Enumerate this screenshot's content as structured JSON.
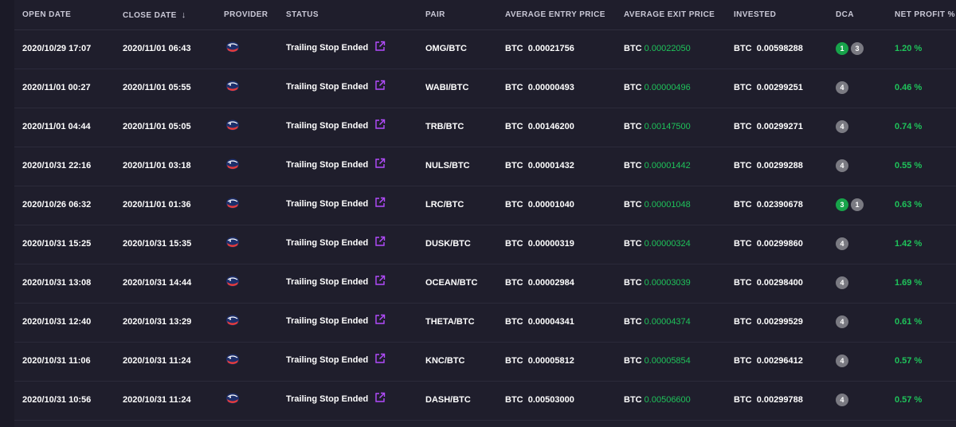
{
  "columns": {
    "open_date": "OPEN DATE",
    "close_date": "CLOSE DATE",
    "provider": "PROVIDER",
    "status": "STATUS",
    "pair": "PAIR",
    "avg_entry": "AVERAGE ENTRY PRICE",
    "avg_exit": "AVERAGE EXIT PRICE",
    "invested": "INVESTED",
    "dca": "DCA",
    "net_profit": "NET PROFIT %"
  },
  "icons": {
    "sort": "arrow-down-icon",
    "provider": "provider-logo-icon",
    "external": "external-link-icon"
  },
  "colors": {
    "background": "#1f1e2c",
    "profit_green": "#1fc35a",
    "dca_green": "#17a34a",
    "dca_grey": "#7a7a82",
    "link_purple": "#b44cff"
  },
  "rows": [
    {
      "open": "2020/10/29 17:07",
      "close": "2020/11/01 06:43",
      "status": "Trailing Stop Ended",
      "pair": "OMG/BTC",
      "entry_cur": "BTC",
      "entry": "0.00021756",
      "exit_cur": "BTC",
      "exit": "0.00022050",
      "inv_cur": "BTC",
      "invested": "0.00598288",
      "dca": [
        {
          "v": "1",
          "c": "green"
        },
        {
          "v": "3",
          "c": "grey"
        }
      ],
      "profit": "1.20 %"
    },
    {
      "open": "2020/11/01 00:27",
      "close": "2020/11/01 05:55",
      "status": "Trailing Stop Ended",
      "pair": "WABI/BTC",
      "entry_cur": "BTC",
      "entry": "0.00000493",
      "exit_cur": "BTC",
      "exit": "0.00000496",
      "inv_cur": "BTC",
      "invested": "0.00299251",
      "dca": [
        {
          "v": "4",
          "c": "grey"
        }
      ],
      "profit": "0.46 %"
    },
    {
      "open": "2020/11/01 04:44",
      "close": "2020/11/01 05:05",
      "status": "Trailing Stop Ended",
      "pair": "TRB/BTC",
      "entry_cur": "BTC",
      "entry": "0.00146200",
      "exit_cur": "BTC",
      "exit": "0.00147500",
      "inv_cur": "BTC",
      "invested": "0.00299271",
      "dca": [
        {
          "v": "4",
          "c": "grey"
        }
      ],
      "profit": "0.74 %"
    },
    {
      "open": "2020/10/31 22:16",
      "close": "2020/11/01 03:18",
      "status": "Trailing Stop Ended",
      "pair": "NULS/BTC",
      "entry_cur": "BTC",
      "entry": "0.00001432",
      "exit_cur": "BTC",
      "exit": "0.00001442",
      "inv_cur": "BTC",
      "invested": "0.00299288",
      "dca": [
        {
          "v": "4",
          "c": "grey"
        }
      ],
      "profit": "0.55 %"
    },
    {
      "open": "2020/10/26 06:32",
      "close": "2020/11/01 01:36",
      "status": "Trailing Stop Ended",
      "pair": "LRC/BTC",
      "entry_cur": "BTC",
      "entry": "0.00001040",
      "exit_cur": "BTC",
      "exit": "0.00001048",
      "inv_cur": "BTC",
      "invested": "0.02390678",
      "dca": [
        {
          "v": "3",
          "c": "green"
        },
        {
          "v": "1",
          "c": "grey"
        }
      ],
      "profit": "0.63 %"
    },
    {
      "open": "2020/10/31 15:25",
      "close": "2020/10/31 15:35",
      "status": "Trailing Stop Ended",
      "pair": "DUSK/BTC",
      "entry_cur": "BTC",
      "entry": "0.00000319",
      "exit_cur": "BTC",
      "exit": "0.00000324",
      "inv_cur": "BTC",
      "invested": "0.00299860",
      "dca": [
        {
          "v": "4",
          "c": "grey"
        }
      ],
      "profit": "1.42 %"
    },
    {
      "open": "2020/10/31 13:08",
      "close": "2020/10/31 14:44",
      "status": "Trailing Stop Ended",
      "pair": "OCEAN/BTC",
      "entry_cur": "BTC",
      "entry": "0.00002984",
      "exit_cur": "BTC",
      "exit": "0.00003039",
      "inv_cur": "BTC",
      "invested": "0.00298400",
      "dca": [
        {
          "v": "4",
          "c": "grey"
        }
      ],
      "profit": "1.69 %"
    },
    {
      "open": "2020/10/31 12:40",
      "close": "2020/10/31 13:29",
      "status": "Trailing Stop Ended",
      "pair": "THETA/BTC",
      "entry_cur": "BTC",
      "entry": "0.00004341",
      "exit_cur": "BTC",
      "exit": "0.00004374",
      "inv_cur": "BTC",
      "invested": "0.00299529",
      "dca": [
        {
          "v": "4",
          "c": "grey"
        }
      ],
      "profit": "0.61 %"
    },
    {
      "open": "2020/10/31 11:06",
      "close": "2020/10/31 11:24",
      "status": "Trailing Stop Ended",
      "pair": "KNC/BTC",
      "entry_cur": "BTC",
      "entry": "0.00005812",
      "exit_cur": "BTC",
      "exit": "0.00005854",
      "inv_cur": "BTC",
      "invested": "0.00296412",
      "dca": [
        {
          "v": "4",
          "c": "grey"
        }
      ],
      "profit": "0.57 %"
    },
    {
      "open": "2020/10/31 10:56",
      "close": "2020/10/31 11:24",
      "status": "Trailing Stop Ended",
      "pair": "DASH/BTC",
      "entry_cur": "BTC",
      "entry": "0.00503000",
      "exit_cur": "BTC",
      "exit": "0.00506600",
      "inv_cur": "BTC",
      "invested": "0.00299788",
      "dca": [
        {
          "v": "4",
          "c": "grey"
        }
      ],
      "profit": "0.57 %"
    }
  ]
}
